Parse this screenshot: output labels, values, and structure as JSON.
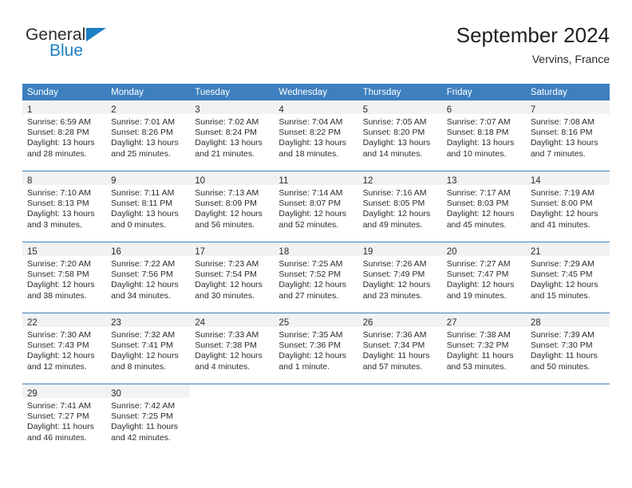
{
  "brand": {
    "name_top": "General",
    "name_bottom": "Blue",
    "accent_color": "#1b7fc4"
  },
  "header": {
    "title": "September 2024",
    "subtitle": "Vervins, France"
  },
  "theme": {
    "header_bg": "#3d7fbf",
    "daynum_bg": "#f2f2f2",
    "text": "#2b2b2b"
  },
  "calendar": {
    "weekday_headers": [
      "Sunday",
      "Monday",
      "Tuesday",
      "Wednesday",
      "Thursday",
      "Friday",
      "Saturday"
    ],
    "weeks": [
      [
        {
          "day": "1",
          "lines": [
            "Sunrise: 6:59 AM",
            "Sunset: 8:28 PM",
            "Daylight: 13 hours",
            "and 28 minutes."
          ]
        },
        {
          "day": "2",
          "lines": [
            "Sunrise: 7:01 AM",
            "Sunset: 8:26 PM",
            "Daylight: 13 hours",
            "and 25 minutes."
          ]
        },
        {
          "day": "3",
          "lines": [
            "Sunrise: 7:02 AM",
            "Sunset: 8:24 PM",
            "Daylight: 13 hours",
            "and 21 minutes."
          ]
        },
        {
          "day": "4",
          "lines": [
            "Sunrise: 7:04 AM",
            "Sunset: 8:22 PM",
            "Daylight: 13 hours",
            "and 18 minutes."
          ]
        },
        {
          "day": "5",
          "lines": [
            "Sunrise: 7:05 AM",
            "Sunset: 8:20 PM",
            "Daylight: 13 hours",
            "and 14 minutes."
          ]
        },
        {
          "day": "6",
          "lines": [
            "Sunrise: 7:07 AM",
            "Sunset: 8:18 PM",
            "Daylight: 13 hours",
            "and 10 minutes."
          ]
        },
        {
          "day": "7",
          "lines": [
            "Sunrise: 7:08 AM",
            "Sunset: 8:16 PM",
            "Daylight: 13 hours",
            "and 7 minutes."
          ]
        }
      ],
      [
        {
          "day": "8",
          "lines": [
            "Sunrise: 7:10 AM",
            "Sunset: 8:13 PM",
            "Daylight: 13 hours",
            "and 3 minutes."
          ]
        },
        {
          "day": "9",
          "lines": [
            "Sunrise: 7:11 AM",
            "Sunset: 8:11 PM",
            "Daylight: 13 hours",
            "and 0 minutes."
          ]
        },
        {
          "day": "10",
          "lines": [
            "Sunrise: 7:13 AM",
            "Sunset: 8:09 PM",
            "Daylight: 12 hours",
            "and 56 minutes."
          ]
        },
        {
          "day": "11",
          "lines": [
            "Sunrise: 7:14 AM",
            "Sunset: 8:07 PM",
            "Daylight: 12 hours",
            "and 52 minutes."
          ]
        },
        {
          "day": "12",
          "lines": [
            "Sunrise: 7:16 AM",
            "Sunset: 8:05 PM",
            "Daylight: 12 hours",
            "and 49 minutes."
          ]
        },
        {
          "day": "13",
          "lines": [
            "Sunrise: 7:17 AM",
            "Sunset: 8:03 PM",
            "Daylight: 12 hours",
            "and 45 minutes."
          ]
        },
        {
          "day": "14",
          "lines": [
            "Sunrise: 7:19 AM",
            "Sunset: 8:00 PM",
            "Daylight: 12 hours",
            "and 41 minutes."
          ]
        }
      ],
      [
        {
          "day": "15",
          "lines": [
            "Sunrise: 7:20 AM",
            "Sunset: 7:58 PM",
            "Daylight: 12 hours",
            "and 38 minutes."
          ]
        },
        {
          "day": "16",
          "lines": [
            "Sunrise: 7:22 AM",
            "Sunset: 7:56 PM",
            "Daylight: 12 hours",
            "and 34 minutes."
          ]
        },
        {
          "day": "17",
          "lines": [
            "Sunrise: 7:23 AM",
            "Sunset: 7:54 PM",
            "Daylight: 12 hours",
            "and 30 minutes."
          ]
        },
        {
          "day": "18",
          "lines": [
            "Sunrise: 7:25 AM",
            "Sunset: 7:52 PM",
            "Daylight: 12 hours",
            "and 27 minutes."
          ]
        },
        {
          "day": "19",
          "lines": [
            "Sunrise: 7:26 AM",
            "Sunset: 7:49 PM",
            "Daylight: 12 hours",
            "and 23 minutes."
          ]
        },
        {
          "day": "20",
          "lines": [
            "Sunrise: 7:27 AM",
            "Sunset: 7:47 PM",
            "Daylight: 12 hours",
            "and 19 minutes."
          ]
        },
        {
          "day": "21",
          "lines": [
            "Sunrise: 7:29 AM",
            "Sunset: 7:45 PM",
            "Daylight: 12 hours",
            "and 15 minutes."
          ]
        }
      ],
      [
        {
          "day": "22",
          "lines": [
            "Sunrise: 7:30 AM",
            "Sunset: 7:43 PM",
            "Daylight: 12 hours",
            "and 12 minutes."
          ]
        },
        {
          "day": "23",
          "lines": [
            "Sunrise: 7:32 AM",
            "Sunset: 7:41 PM",
            "Daylight: 12 hours",
            "and 8 minutes."
          ]
        },
        {
          "day": "24",
          "lines": [
            "Sunrise: 7:33 AM",
            "Sunset: 7:38 PM",
            "Daylight: 12 hours",
            "and 4 minutes."
          ]
        },
        {
          "day": "25",
          "lines": [
            "Sunrise: 7:35 AM",
            "Sunset: 7:36 PM",
            "Daylight: 12 hours",
            "and 1 minute."
          ]
        },
        {
          "day": "26",
          "lines": [
            "Sunrise: 7:36 AM",
            "Sunset: 7:34 PM",
            "Daylight: 11 hours",
            "and 57 minutes."
          ]
        },
        {
          "day": "27",
          "lines": [
            "Sunrise: 7:38 AM",
            "Sunset: 7:32 PM",
            "Daylight: 11 hours",
            "and 53 minutes."
          ]
        },
        {
          "day": "28",
          "lines": [
            "Sunrise: 7:39 AM",
            "Sunset: 7:30 PM",
            "Daylight: 11 hours",
            "and 50 minutes."
          ]
        }
      ],
      [
        {
          "day": "29",
          "lines": [
            "Sunrise: 7:41 AM",
            "Sunset: 7:27 PM",
            "Daylight: 11 hours",
            "and 46 minutes."
          ]
        },
        {
          "day": "30",
          "lines": [
            "Sunrise: 7:42 AM",
            "Sunset: 7:25 PM",
            "Daylight: 11 hours",
            "and 42 minutes."
          ]
        },
        {
          "day": "",
          "lines": []
        },
        {
          "day": "",
          "lines": []
        },
        {
          "day": "",
          "lines": []
        },
        {
          "day": "",
          "lines": []
        },
        {
          "day": "",
          "lines": []
        }
      ]
    ]
  }
}
